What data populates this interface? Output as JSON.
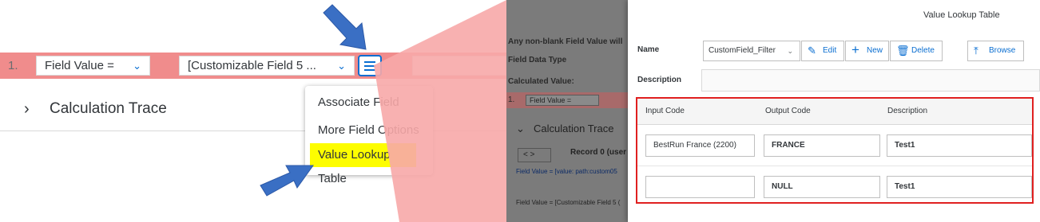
{
  "left": {
    "row_number": "1.",
    "field_select": "Field Value =",
    "customizable_select": "[Customizable Field 5  ...",
    "calc_trace_title": "Calculation Trace"
  },
  "popover": {
    "items": [
      "Associate Field",
      "More Field Options",
      "Value Lookup Table"
    ]
  },
  "middle": {
    "line1": "Any non-blank Field Value will",
    "line2": "Field Data Type",
    "line3": "Calculated Value:",
    "row_number": "1.",
    "select": "Field Value =",
    "calc_title": "Calculation Trace",
    "nav": "<  >",
    "record": "Record 0 (user",
    "fv_line1": "Field Value = [value: path:custom05",
    "fv_line2": "Field Value = [Customizable Field 5 ("
  },
  "dialog": {
    "title": "Value Lookup Table",
    "name_label": "Name",
    "name_value": "CustomField_Filter",
    "edit_label": "Edit",
    "new_label": "New",
    "delete_label": "Delete",
    "browse_label": "Browse",
    "description_label": "Description",
    "columns": [
      "Input Code",
      "Output Code",
      "Description"
    ],
    "rows": [
      {
        "input": "BestRun France (2200)",
        "output": "FRANCE",
        "description": "Test1"
      },
      {
        "input": "",
        "output": "NULL",
        "description": "Test1"
      }
    ]
  },
  "colors": {
    "row_highlight": "#f08c8c",
    "accent": "#0a6ed1",
    "highlight_yellow": "#fdfd00",
    "table_border": "#e02020",
    "arrow": "#3a6fc4"
  }
}
